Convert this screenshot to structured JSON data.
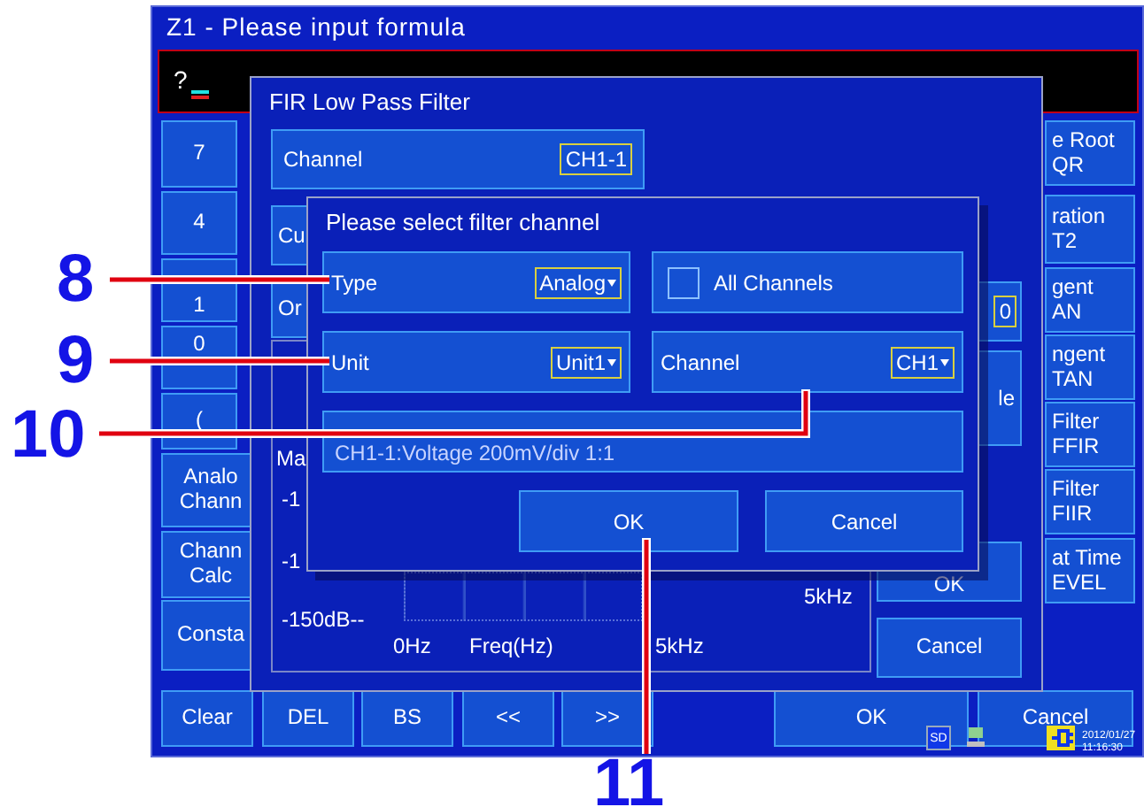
{
  "header": {
    "title": "Z1 - Please input formula",
    "prompt": "?"
  },
  "left_keys": [
    {
      "lines": [
        "7"
      ]
    },
    {
      "lines": [
        "4"
      ]
    },
    {
      "lines": [
        "1"
      ]
    },
    {
      "lines": [
        "0"
      ]
    },
    {
      "lines": [
        "("
      ]
    },
    {
      "lines": [
        "Analo",
        "Chann"
      ]
    },
    {
      "lines": [
        "Chann",
        "Calc"
      ]
    },
    {
      "lines": [
        "Consta"
      ]
    }
  ],
  "right_keys": [
    {
      "lines": [
        "e Root",
        "QR"
      ]
    },
    {
      "lines": [
        "ration",
        "T2"
      ]
    },
    {
      "lines": [
        "gent",
        "AN"
      ]
    },
    {
      "lines": [
        "ngent",
        "TAN"
      ]
    },
    {
      "lines": [
        "Filter",
        "FFIR"
      ]
    },
    {
      "lines": [
        "Filter",
        "FIIR"
      ]
    },
    {
      "lines": [
        "at Time",
        "EVEL"
      ]
    }
  ],
  "bottom_keys": [
    {
      "label": "Clear"
    },
    {
      "label": "DEL"
    },
    {
      "label": "BS"
    },
    {
      "label": "<<"
    },
    {
      "label": ">>"
    },
    {
      "label": "OK"
    },
    {
      "label": "Cancel"
    }
  ],
  "fir_dialog": {
    "title": "FIR Low Pass Filter",
    "channel": {
      "label": "Channel",
      "value": "CH1-1"
    },
    "rows": [
      "Cu",
      "Or"
    ],
    "graph_labels": [
      "Ma",
      "-1",
      "-1",
      "-150dB--",
      "0Hz",
      "Freq(Hz)",
      "5kHz",
      "5kHz"
    ],
    "side_field": "0",
    "side_button": "le",
    "buttons": [
      "OK",
      "Cancel"
    ]
  },
  "select_dialog": {
    "title": "Please select filter channel",
    "fields": [
      {
        "kind": "dropdown",
        "label": "Type",
        "value": "Analog"
      },
      {
        "kind": "checkbox",
        "label": "All Channels",
        "checked": false
      },
      {
        "kind": "dropdown",
        "label": "Unit",
        "value": "Unit1"
      },
      {
        "kind": "dropdown",
        "label": "Channel",
        "value": "CH1"
      }
    ],
    "info": "CH1-1:Voltage 200mV/div 1:1",
    "buttons": [
      "OK",
      "Cancel"
    ]
  },
  "status": {
    "storage": "SD",
    "date": "2012/01/27",
    "time": "11:16:30"
  },
  "callouts": [
    "8",
    "9",
    "10",
    "11"
  ]
}
